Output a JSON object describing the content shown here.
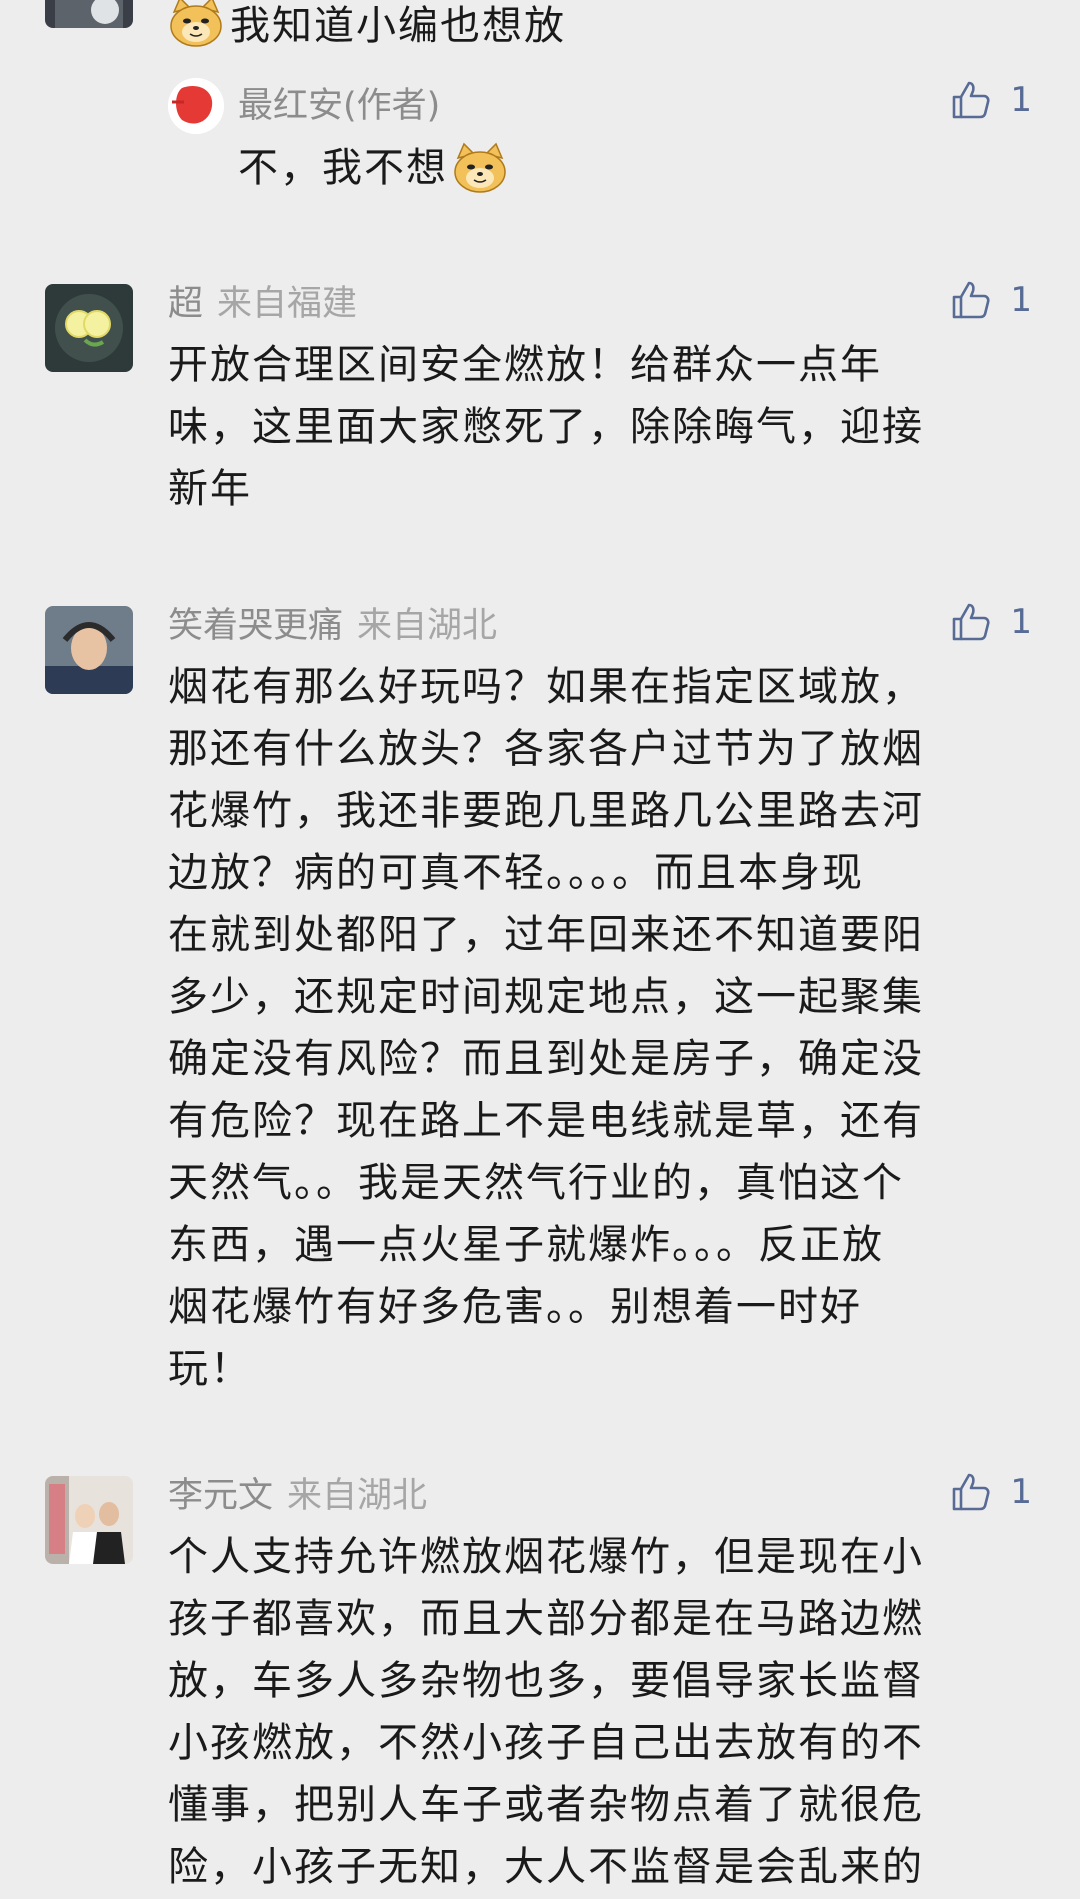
{
  "top_comment": {
    "text": "我知道小编也想放",
    "emoji": "doge-emoji"
  },
  "author_reply": {
    "name": "最红安(作者)",
    "text": "不，我不想",
    "emoji": "doge-emoji",
    "likes": "1"
  },
  "comments": [
    {
      "username": "超",
      "location": "来自福建",
      "likes": "1",
      "text": "开放合理区间安全燃放！给群众一点年\n味，这里面大家憋死了，除除晦气，迎接\n新年"
    },
    {
      "username": "笑着哭更痛",
      "location": "来自湖北",
      "likes": "1",
      "text": "烟花有那么好玩吗？如果在指定区域放，\n那还有什么放头？各家各户过节为了放烟\n花爆竹，我还非要跑几里路几公里路去河\n边放？病的可真不轻。。。。而且本身现\n在就到处都阳了，过年回来还不知道要阳\n多少，还规定时间规定地点，这一起聚集\n确定没有风险？而且到处是房子，确定没\n有危险？现在路上不是电线就是草，还有\n天然气。。我是天然气行业的，真怕这个\n东西，遇一点火星子就爆炸。。。反正放\n烟花爆竹有好多危害。。别想着一时好\n玩！"
    },
    {
      "username": "李元文",
      "location": "来自湖北",
      "likes": "1",
      "text": "个人支持允许燃放烟花爆竹，但是现在小\n孩子都喜欢，而且大部分都是在马路边燃\n放，车多人多杂物也多，要倡导家长监督\n小孩燃放，不然小孩子自己出去放有的不\n懂事，把别人车子或者杂物点着了就很危\n险，小孩子无知，大人不监督是会乱来的"
    }
  ],
  "colors": {
    "background": "#ededed",
    "meta": "#8c8c8c",
    "like": "#576b95",
    "text": "#1a1a1a"
  }
}
